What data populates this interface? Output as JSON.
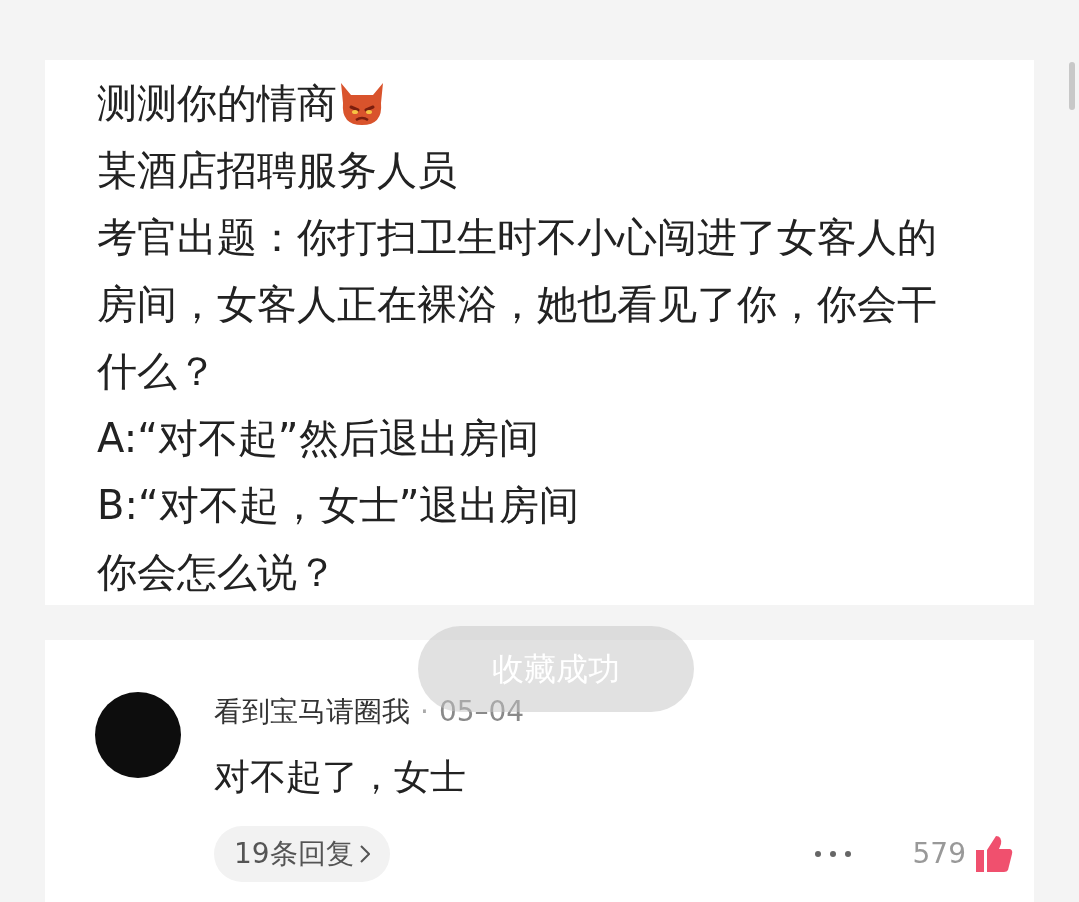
{
  "post": {
    "title": "测测你的情商",
    "lines": [
      "某酒店招聘服务人员",
      "考官出题：你打扫卫生时不小心闯进了女客人的房间，女客人正在裸浴，她也看见了你，你会干什么？",
      "A:“对不起”然后退出房间",
      "B:“对不起，女士”退出房间",
      "你会怎么说？"
    ]
  },
  "toast": {
    "text": "收藏成功"
  },
  "comment": {
    "username": "看到宝马请圈我",
    "separator": "·",
    "date": "05–04",
    "text": "对不起了，女士",
    "replies": "19条回复",
    "likes": "579"
  }
}
